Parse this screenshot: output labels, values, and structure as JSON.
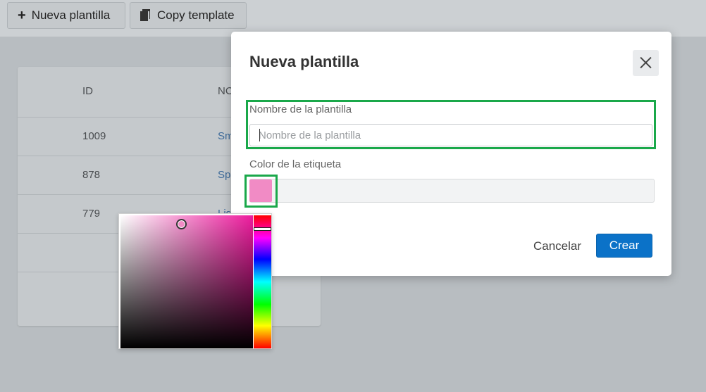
{
  "toolbar": {
    "new_template_label": "Nueva plantilla",
    "copy_template_label": "Copy template"
  },
  "table": {
    "columns": [
      "ID",
      "NC"
    ],
    "rows": [
      {
        "id": "1009",
        "name": "Sm"
      },
      {
        "id": "878",
        "name": "Sp"
      },
      {
        "id": "779",
        "name": "Lis"
      }
    ]
  },
  "modal": {
    "title": "Nueva plantilla",
    "name_label": "Nombre de la plantilla",
    "name_placeholder": "Nombre de la plantilla",
    "name_value": "",
    "color_label": "Color de la etiqueta",
    "selected_color": "#f18bc5",
    "cancel_label": "Cancelar",
    "create_label": "Crear"
  },
  "colors": {
    "accent": "#0b72c8",
    "highlight": "#1aa84a",
    "picker_hue": "#ee1c9e"
  }
}
